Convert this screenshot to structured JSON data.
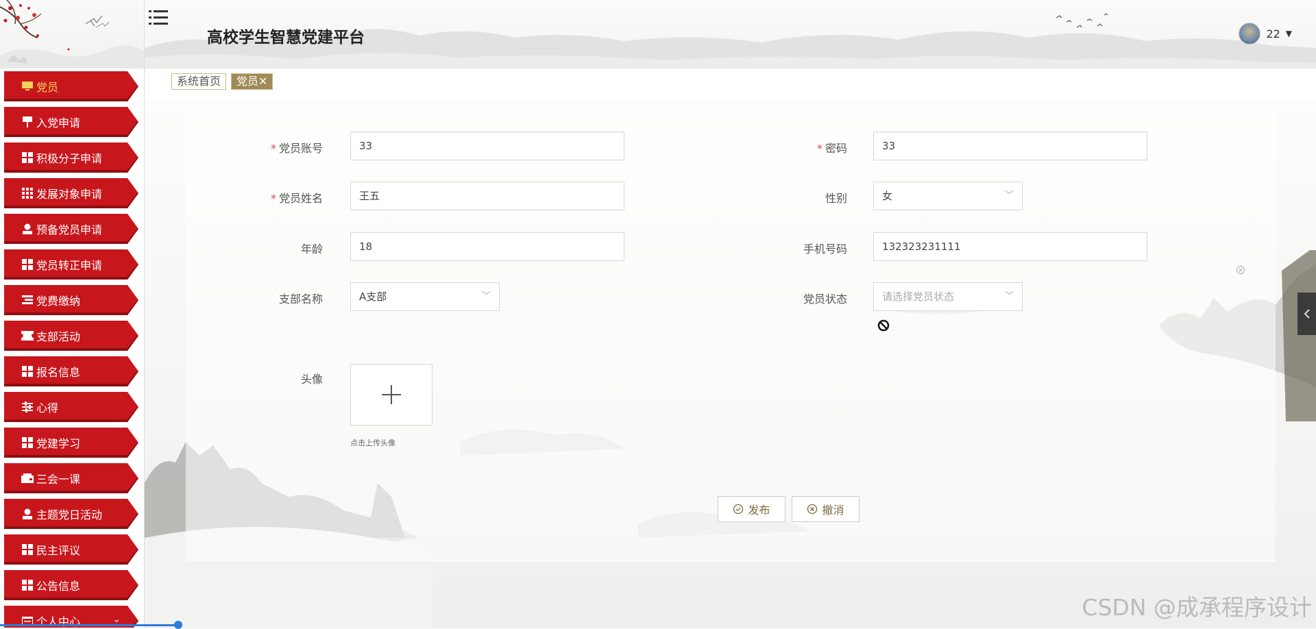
{
  "header": {
    "title": "高校学生智慧党建平台",
    "username": "22",
    "menu_icon": "hamburger-icon",
    "avatar_icon": "user-avatar"
  },
  "tabs": [
    {
      "label": "系统首页"
    },
    {
      "label": "党员",
      "close": "✕"
    }
  ],
  "sidebar": {
    "items": [
      {
        "label": "党员",
        "icon": "monitor-icon",
        "active": true
      },
      {
        "label": "入党申请",
        "icon": "pin-icon"
      },
      {
        "label": "积极分子申请",
        "icon": "grid-icon"
      },
      {
        "label": "发展对象申请",
        "icon": "apps-icon"
      },
      {
        "label": "预备党员申请",
        "icon": "person-icon"
      },
      {
        "label": "党员转正申请",
        "icon": "grid-icon"
      },
      {
        "label": "党费缴纳",
        "icon": "list-icon"
      },
      {
        "label": "支部活动",
        "icon": "ticket-icon"
      },
      {
        "label": "报名信息",
        "icon": "grid-icon"
      },
      {
        "label": "心得",
        "icon": "sliders-icon"
      },
      {
        "label": "党建学习",
        "icon": "grid-icon"
      },
      {
        "label": "三会一课",
        "icon": "wallet-icon"
      },
      {
        "label": "主题党日活动",
        "icon": "person-icon"
      },
      {
        "label": "民主评议",
        "icon": "grid-icon"
      },
      {
        "label": "公告信息",
        "icon": "grid-icon"
      },
      {
        "label": "个人中心",
        "icon": "calendar-icon",
        "chevron": "⌄"
      }
    ]
  },
  "form": {
    "account": {
      "label": "党员账号",
      "value": "33",
      "required": true
    },
    "password": {
      "label": "密码",
      "value": "33",
      "required": true
    },
    "name": {
      "label": "党员姓名",
      "value": "王五",
      "required": true
    },
    "gender": {
      "label": "性别",
      "value": "女"
    },
    "age": {
      "label": "年龄",
      "value": "18"
    },
    "phone": {
      "label": "手机号码",
      "value": "132323231111"
    },
    "branch": {
      "label": "支部名称",
      "value": "A支部"
    },
    "status": {
      "label": "党员状态",
      "placeholder": "请选择党员状态"
    },
    "avatar": {
      "label": "头像",
      "hint": "点击上传头像",
      "icon": "plus-icon"
    }
  },
  "buttons": {
    "submit": "发布",
    "cancel": "撤消"
  },
  "watermark": "CSDN @成承程序设计",
  "colors": {
    "sidebar_red": "#c8161d",
    "active_label": "#f5d259",
    "tab_active": "#a08a55",
    "required": "#e04848"
  }
}
